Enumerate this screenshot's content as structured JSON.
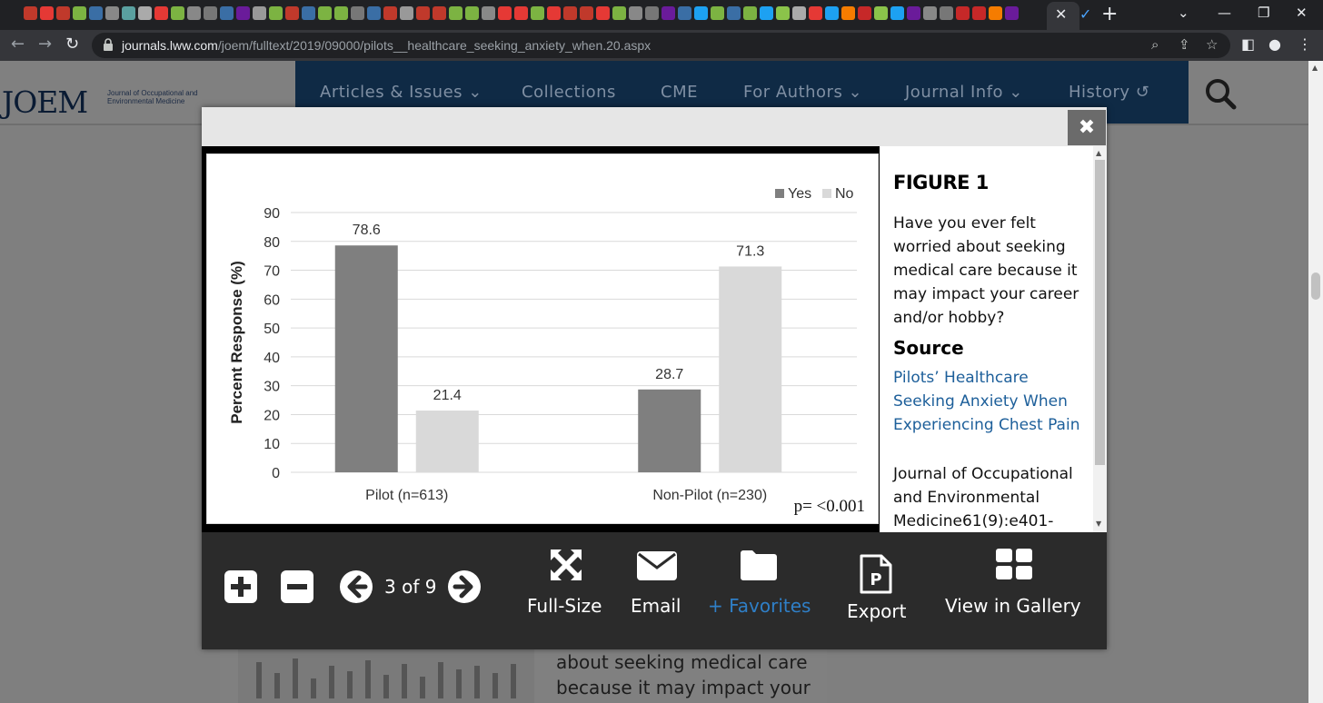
{
  "browser": {
    "url_host": "journals.lww.com",
    "url_path": "/joem/fulltext/2019/09000/pilots__healthcare_seeking_anxiety_when.20.aspx"
  },
  "site": {
    "logo_main": "JOEM",
    "logo_sub": "Journal of Occupational and Environmental Medicine",
    "nav": [
      "Articles & Issues",
      "Collections",
      "CME",
      "For Authors",
      "Journal Info",
      "History"
    ]
  },
  "background_article": {
    "text": "about seeking medical care because it may impact your"
  },
  "modal": {
    "caption": {
      "figure_label": "FIGURE 1",
      "question": "Have you ever felt worried about seeking medical care because it may impact your career and/or hobby?",
      "source_heading": "Source",
      "source_link": "Pilots’ Healthcare Seeking Anxiety When Experiencing Chest Pain",
      "journal_ref": "Journal of Occupational and Environmental Medicine61(9):e401-"
    },
    "controls": {
      "page_indicator": "3 of 9",
      "full_size": "Full-Size",
      "email": "Email",
      "favorites": "+ Favorites",
      "export": "Export",
      "gallery": "View in Gallery"
    }
  },
  "colors": {
    "yes": "#7f7f7f",
    "no": "#d9d9d9",
    "link": "#1d5f9a",
    "nav_bg": "#0f2a45"
  },
  "chart_data": {
    "type": "bar",
    "categories": [
      "Pilot (n=613)",
      "Non-Pilot (n=230)"
    ],
    "series": [
      {
        "name": "Yes",
        "values": [
          78.6,
          28.7
        ]
      },
      {
        "name": "No",
        "values": [
          21.4,
          71.3
        ]
      }
    ],
    "ylabel": "Percent Response (%)",
    "ylim": [
      0,
      90
    ],
    "yticks": [
      0,
      10,
      20,
      30,
      40,
      50,
      60,
      70,
      80,
      90
    ],
    "annotation": "p= <0.001",
    "grid": true,
    "legend": "top-right"
  }
}
